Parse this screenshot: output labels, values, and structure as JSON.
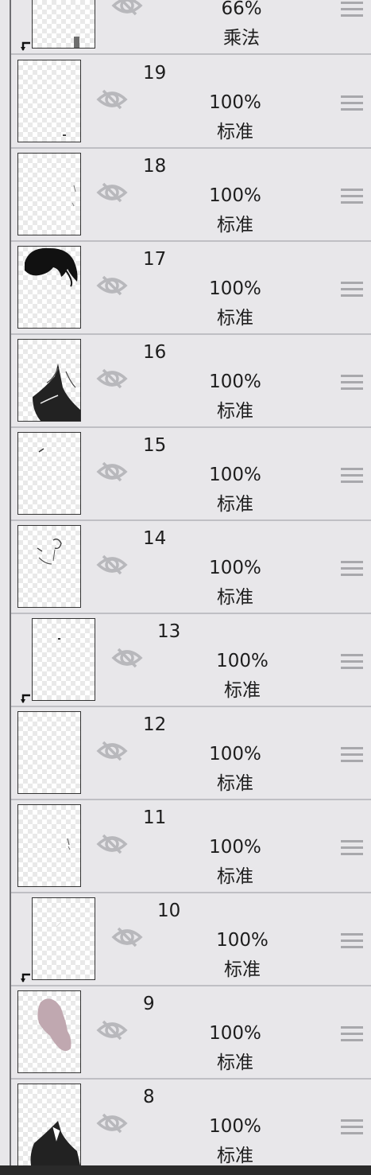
{
  "layers": [
    {
      "number": "",
      "opacity": "66%",
      "blend": "乘法"
    },
    {
      "number": "19",
      "opacity": "100%",
      "blend": "标准"
    },
    {
      "number": "18",
      "opacity": "100%",
      "blend": "标准"
    },
    {
      "number": "17",
      "opacity": "100%",
      "blend": "标准"
    },
    {
      "number": "16",
      "opacity": "100%",
      "blend": "标准"
    },
    {
      "number": "15",
      "opacity": "100%",
      "blend": "标准"
    },
    {
      "number": "14",
      "opacity": "100%",
      "blend": "标准"
    },
    {
      "number": "13",
      "opacity": "100%",
      "blend": "标准"
    },
    {
      "number": "12",
      "opacity": "100%",
      "blend": "标准"
    },
    {
      "number": "11",
      "opacity": "100%",
      "blend": "标准"
    },
    {
      "number": "10",
      "opacity": "100%",
      "blend": "标准"
    },
    {
      "number": "9",
      "opacity": "100%",
      "blend": "标准"
    },
    {
      "number": "8",
      "opacity": "100%",
      "blend": "标准"
    }
  ],
  "icons": {
    "visibility": "eye-hidden-icon",
    "drag": "drag-handle-icon",
    "clip": "clip-arrow-icon"
  },
  "colors": {
    "background": "#e8e7ea",
    "text": "#1d1d1d",
    "icon": "#b8b8bc",
    "layer9_fill": "#c0a8b0"
  }
}
